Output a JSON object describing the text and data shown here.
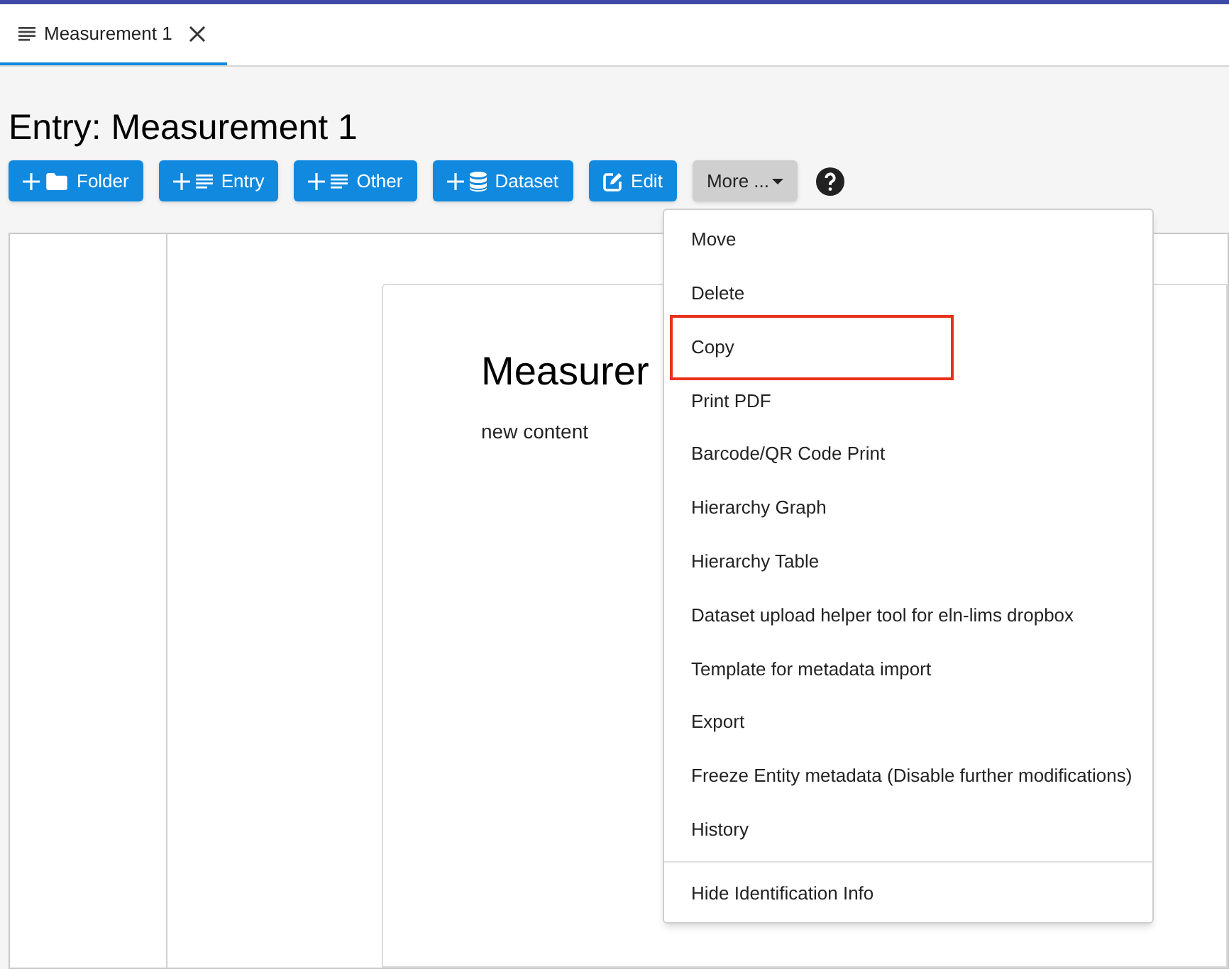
{
  "tabs": [
    {
      "label": "Measurement 1",
      "selected": true
    }
  ],
  "page": {
    "title": "Entry: Measurement 1"
  },
  "toolbar": {
    "buttons": [
      {
        "label": "Folder",
        "kind": "folder"
      },
      {
        "label": "Entry",
        "kind": "entry"
      },
      {
        "label": "Other",
        "kind": "entry"
      },
      {
        "label": "Dataset",
        "kind": "dataset"
      },
      {
        "label": "Edit",
        "kind": "edit"
      }
    ],
    "more_button": {
      "label": "More ...",
      "expanded": true
    }
  },
  "content": {
    "heading": "Measurer",
    "body": "new content"
  },
  "menu": {
    "items": [
      {
        "label": "Move",
        "highlighted": false
      },
      {
        "label": "Delete",
        "highlighted": false
      },
      {
        "label": "Copy",
        "highlighted": true
      },
      {
        "label": "Print PDF",
        "highlighted": false
      },
      {
        "label": "Barcode/QR Code Print",
        "highlighted": false
      },
      {
        "label": "Hierarchy Graph",
        "highlighted": false
      },
      {
        "label": "Hierarchy Table",
        "highlighted": false
      },
      {
        "label": "Dataset upload helper tool for eln-lims dropbox",
        "highlighted": false
      },
      {
        "label": "Template for metadata import",
        "highlighted": false
      },
      {
        "label": "Export",
        "highlighted": false
      },
      {
        "label": "Freeze Entity metadata (Disable further modifications)",
        "highlighted": false
      },
      {
        "label": "History",
        "highlighted": false
      }
    ],
    "footer_items": [
      {
        "label": "Hide Identification Info",
        "highlighted": false
      }
    ]
  }
}
